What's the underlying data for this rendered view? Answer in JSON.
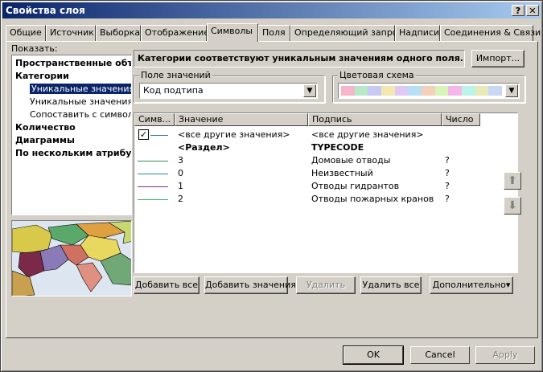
{
  "window": {
    "title": "Свойства слоя",
    "help_label": "?",
    "close_label": "✕"
  },
  "tabs": [
    {
      "label": "Общие"
    },
    {
      "label": "Источник"
    },
    {
      "label": "Выборка"
    },
    {
      "label": "Отображение"
    },
    {
      "label": "Символы"
    },
    {
      "label": "Поля"
    },
    {
      "label": "Определяющий запрос"
    },
    {
      "label": "Надписи"
    },
    {
      "label": "Соединения & Связи"
    }
  ],
  "show": {
    "label": "Показать:",
    "items": [
      {
        "label": "Пространственные объ"
      },
      {
        "label": "Категории"
      },
      {
        "label": "Уникальные значения"
      },
      {
        "label": "Уникальные значения, м"
      },
      {
        "label": "Сопоставить с символа"
      },
      {
        "label": "Количество"
      },
      {
        "label": "Диаграммы"
      },
      {
        "label": "По нескольким атрибут"
      }
    ]
  },
  "header": {
    "text": "Категории соответствуют уникальным значениям одного поля.",
    "import_label": "Импорт..."
  },
  "value_field": {
    "title": "Поле значений",
    "value": "Код подтипа"
  },
  "color_scheme": {
    "title": "Цветовая схема",
    "colors": [
      "#f4b6c8",
      "#b8e8c8",
      "#c8c8f4",
      "#f4e8b0",
      "#e0c8f4",
      "#b8e0f4",
      "#f4d0b8",
      "#d8f4b8",
      "#f4b8e8",
      "#b8f4e8",
      "#e8e8b8",
      "#c8d8f4"
    ]
  },
  "table": {
    "headers": {
      "symbol": "Симв...",
      "value": "Значение",
      "label": "Подпись",
      "count": "Число"
    },
    "rows": [
      {
        "value": "<все другие значения>",
        "label": "<все другие значения>",
        "count": "",
        "line_color": "#2e7d8f",
        "checked": true
      },
      {
        "value": "<Раздел>",
        "label": "TYPECODE",
        "count": "",
        "heading": true
      },
      {
        "value": "3",
        "label": "Домовые отводы",
        "count": "?",
        "line_color": "#2e8b57"
      },
      {
        "value": "0",
        "label": "Неизвестный",
        "count": "?",
        "line_color": "#1e90a0"
      },
      {
        "value": "1",
        "label": "Отводы гидрантов",
        "count": "?",
        "line_color": "#7b2c8f"
      },
      {
        "value": "2",
        "label": "Отводы пожарных кранов",
        "count": "?",
        "line_color": "#3cb371"
      }
    ]
  },
  "actions": {
    "add_all": "Добавить все",
    "add_values": "Добавить значения",
    "remove": "Удалить",
    "remove_all": "Удалить все",
    "advanced": "Дополнительно"
  },
  "footer": {
    "ok": "OK",
    "cancel": "Cancel",
    "apply": "Apply"
  }
}
